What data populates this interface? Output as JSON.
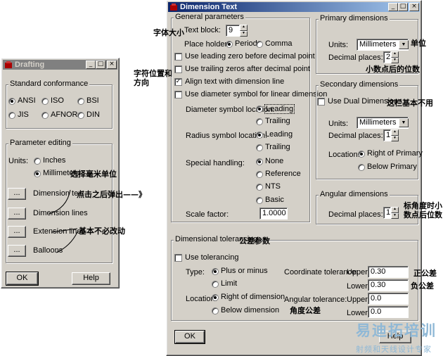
{
  "drafting": {
    "title": "Drafting",
    "standard_group": "Standard conformance",
    "standards": [
      {
        "label": "ANSI",
        "checked": true
      },
      {
        "label": "ISO",
        "checked": false
      },
      {
        "label": "BSI",
        "checked": false
      },
      {
        "label": "JIS",
        "checked": false
      },
      {
        "label": "AFNOR",
        "checked": false
      },
      {
        "label": "DIN",
        "checked": false
      }
    ],
    "param_group": "Parameter editing",
    "units_label": "Units:",
    "unit_inches": "Inches",
    "unit_mm": "Millimeters",
    "ellipsis": "...",
    "dimension_text": "Dimension text",
    "dimension_lines": "Dimension lines",
    "extension_lines": "Extension lines",
    "balloons": "Balloons",
    "ok": "OK",
    "help": "Help"
  },
  "dimtext": {
    "title": "Dimension Text",
    "general": {
      "legend": "General parameters",
      "text_block_label": "Text block:",
      "text_block_value": "9",
      "place_holder_label": "Place holder:",
      "period": "Period",
      "comma": "Comma",
      "leading_zero": "Use leading zero before decimal point",
      "trailing_zeros": "Use trailing zeros after decimal point",
      "align_text": "Align text with dimension line",
      "diameter_symbol": "Use diameter symbol for linear dimension",
      "diameter_loc_label": "Diameter symbol location:",
      "radius_loc_label": "Radius symbol location:",
      "leading": "Leading",
      "trailing": "Trailing",
      "special_label": "Special handling:",
      "none": "None",
      "reference": "Reference",
      "nts": "NTS",
      "basic": "Basic",
      "scale_label": "Scale factor:",
      "scale_value": "1.0000"
    },
    "primary": {
      "legend": "Primary dimensions",
      "units_label": "Units:",
      "units_value": "Millimeters",
      "decimal_label": "Decimal places:",
      "decimal_value": "2"
    },
    "secondary": {
      "legend": "Secondary dimensions",
      "dual": "Use Dual Dimensions",
      "units_label": "Units:",
      "units_value": "Millimeters",
      "decimal_label": "Decimal places:",
      "decimal_value": "1",
      "location_label": "Location:",
      "right_of_primary": "Right of Primary",
      "below_primary": "Below Primary"
    },
    "angular": {
      "legend": "Angular dimensions",
      "decimal_label": "Decimal places:",
      "decimal_value": "1"
    },
    "tolerancing": {
      "legend": "Dimensional tolerancing",
      "use_tolerancing": "Use tolerancing",
      "type_label": "Type:",
      "plus_minus": "Plus or minus",
      "limit": "Limit",
      "location_label": "Location:",
      "right_of_dimension": "Right of dimension",
      "below_dimension": "Below dimension",
      "coord_label": "Coordinate tolerance:",
      "angular_label": "Angular tolerance:",
      "upper": "Upper:",
      "lower": "Lower:",
      "coord_upper": "0.30",
      "coord_lower": "0.30",
      "ang_upper": "0.0",
      "ang_lower": "0.0"
    },
    "ok": "OK",
    "help": "Help"
  },
  "annotations": {
    "font_size": "字体大小",
    "char_pos_1": "字符位置和",
    "char_pos_2": "方向",
    "choose_mm": "选择毫米单位",
    "popup": "点击之后弹出——》",
    "no_change": "基本不必改动",
    "unit": "单位",
    "decimal_places": "小数点后的位数",
    "not_used": "这栏基本不用",
    "angle_decimal_1": "标角度时小",
    "angle_decimal_2": "数点后位数",
    "tolerance_params": "公差参数",
    "positive_tol": "正公差",
    "negative_tol": "负公差",
    "angle_tol": "角度公差"
  },
  "watermark": {
    "brand": "易迪拓培训",
    "subtitle": "射频和天线设计专家"
  }
}
